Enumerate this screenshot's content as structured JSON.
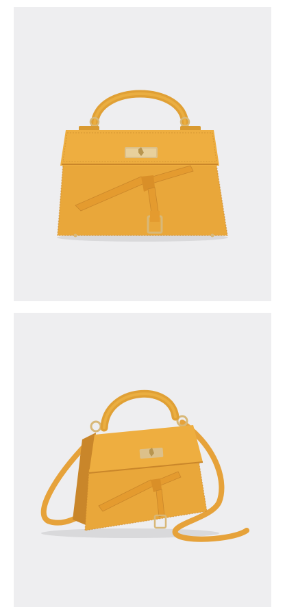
{
  "images": [
    {
      "subject": "handbag-front-view",
      "colors": {
        "bag": "#e9a73a",
        "bag_shadow": "#c9862a",
        "hardware": "#d8b878",
        "background": "#eeeef0"
      }
    },
    {
      "subject": "handbag-angled-with-strap",
      "colors": {
        "bag": "#e9a73a",
        "bag_shadow": "#c9862a",
        "hardware": "#d8b878",
        "background": "#eeeef0"
      }
    }
  ]
}
